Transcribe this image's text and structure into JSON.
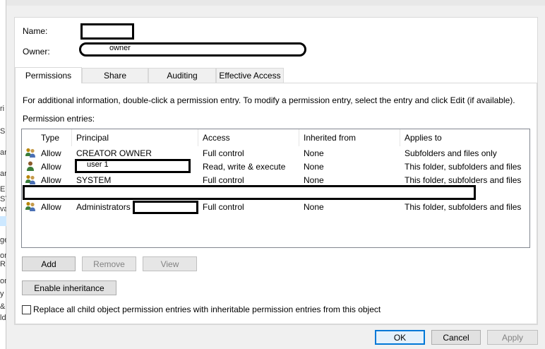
{
  "dialog": {
    "name_label": "Name:",
    "owner_label": "Owner:",
    "owner_value": "owner",
    "tabs": [
      {
        "label": "Permissions",
        "active": true
      },
      {
        "label": "Share",
        "active": false
      },
      {
        "label": "Auditing",
        "active": false
      },
      {
        "label": "Effective Access",
        "active": false
      }
    ],
    "info_text": "For additional information, double-click a permission entry. To modify a permission entry, select the entry and click Edit (if available).",
    "entries_label": "Permission entries:",
    "columns": [
      "Type",
      "Principal",
      "Access",
      "Inherited from",
      "Applies to"
    ],
    "rows": [
      {
        "type": "Allow",
        "principal": "CREATOR OWNER",
        "access": "Full control",
        "inherited": "None",
        "applies": "Subfolders and files only",
        "icon": "group-users-icon"
      },
      {
        "type": "Allow",
        "principal": "user 1",
        "access": "Read, write & execute",
        "inherited": "None",
        "applies": "This folder, subfolders and files",
        "icon": "single-user-icon"
      },
      {
        "type": "Allow",
        "principal": "SYSTEM",
        "access": "Full control",
        "inherited": "None",
        "applies": "This folder, subfolders and files",
        "icon": "group-users-icon"
      },
      {
        "type": "",
        "principal": "",
        "access": "",
        "inherited": "",
        "applies": "",
        "icon": "group-users-icon"
      },
      {
        "type": "Allow",
        "principal": "Administrators",
        "access": "Full control",
        "inherited": "None",
        "applies": "This folder, subfolders and files",
        "icon": "group-users-icon"
      }
    ],
    "buttons": {
      "add": "Add",
      "remove": "Remove",
      "view": "View",
      "enable_inheritance": "Enable inheritance",
      "ok": "OK",
      "cancel": "Cancel",
      "apply": "Apply"
    },
    "replace_checkbox_label": "Replace all child object permission entries with inheritable permission entries from this object"
  },
  "background_window": {
    "glyphs": [
      "ri",
      "S",
      "ar",
      "ar",
      "E",
      "ST",
      "va",
      "ge",
      "on",
      "R",
      "on",
      "y",
      "&",
      "ld"
    ]
  },
  "colors": {
    "accent": "#0078d7",
    "redaction": "#000000",
    "panel": "#ffffff",
    "chrome": "#f0f0f0"
  }
}
